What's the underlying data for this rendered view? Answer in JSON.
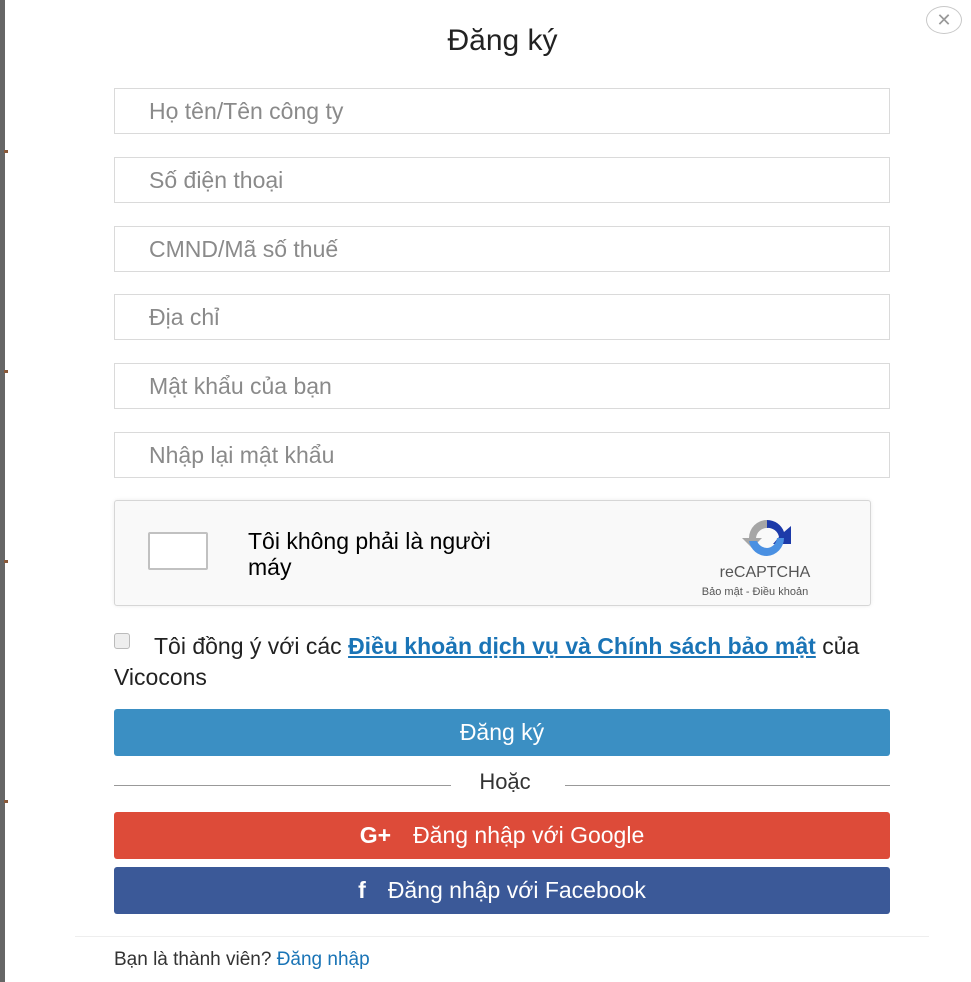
{
  "dialog": {
    "title": "Đăng ký",
    "close_icon": "close-icon",
    "close_glyph": "✕"
  },
  "fields": [
    {
      "placeholder": "Họ tên/Tên công ty"
    },
    {
      "placeholder": "Số điện thoại"
    },
    {
      "placeholder": "CMND/Mã số thuế"
    },
    {
      "placeholder": "Địa chỉ"
    },
    {
      "placeholder": "Mật khẩu của bạn"
    },
    {
      "placeholder": "Nhập lại mật khẩu"
    }
  ],
  "captcha": {
    "label": "Tôi không phải là người máy",
    "brand": "reCAPTCHA",
    "links": "Bảo mật - Điều khoản",
    "logo_icon": "recaptcha-logo-icon"
  },
  "terms": {
    "prefix": "Tôi đồng ý với các ",
    "link": "Điều khoản dịch vụ và Chính sách bảo mật",
    "suffix": " của Vicocons"
  },
  "buttons": {
    "register": "Đăng ký",
    "or": "Hoặc",
    "google_icon": "G+",
    "google": "Đăng nhập với Google",
    "facebook_icon": "f",
    "facebook": "Đăng nhập với Facebook"
  },
  "footer": {
    "text": "Bạn là thành viên? ",
    "link": "Đăng nhập"
  },
  "colors": {
    "register": "#3b8fc3",
    "google": "#dd4b39",
    "facebook": "#3b5998",
    "link": "#1a74b6"
  }
}
